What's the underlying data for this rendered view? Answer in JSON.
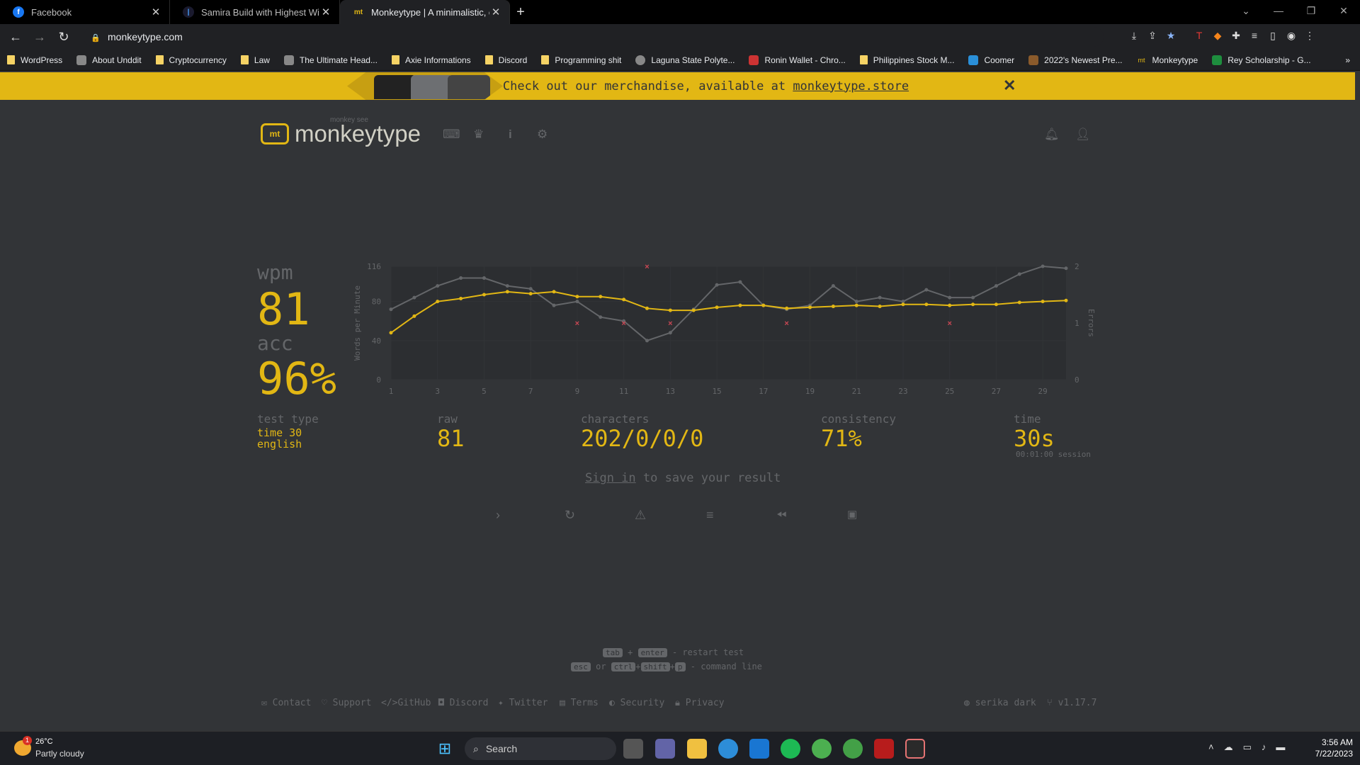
{
  "browser": {
    "tabs": [
      {
        "title": "Facebook",
        "icon": "facebook-icon"
      },
      {
        "title": "Samira Build with Highest Winrat",
        "icon": "blitz-icon"
      },
      {
        "title": "Monkeytype | A minimalistic, cust",
        "icon": "monkeytype-icon"
      }
    ],
    "url": "monkeytype.com",
    "bookmarks": [
      "WordPress",
      "About Unddit",
      "Cryptocurrency",
      "Law",
      "The Ultimate Head...",
      "Axie Informations",
      "Discord",
      "Programming shit",
      "Laguna State Polyte...",
      "Ronin Wallet - Chro...",
      "Philippines Stock M...",
      "Coomer",
      "2022's Newest Pre...",
      "Monkeytype",
      "Rey Scholarship - G..."
    ]
  },
  "banner": {
    "text": "Check out our merchandise, available at ",
    "link": "monkeytype.store",
    "close": "✕"
  },
  "header": {
    "logo": "monkeytype",
    "logo_sub": "monkey see",
    "logo_mark": "mt"
  },
  "result": {
    "wpm_label": "wpm",
    "wpm": "81",
    "acc_label": "acc",
    "acc": "96%",
    "test_type_label": "test type",
    "test_type_1": "time 30",
    "test_type_2": "english",
    "raw_label": "raw",
    "raw": "81",
    "characters_label": "characters",
    "characters": "202/0/0/0",
    "consistency_label": "consistency",
    "consistency": "71%",
    "time_label": "time",
    "time": "30s",
    "session": "00:01:00 session",
    "sign_in": "Sign in",
    "save_text": " to save your result"
  },
  "chart_data": {
    "type": "line",
    "x": [
      1,
      2,
      3,
      4,
      5,
      6,
      7,
      8,
      9,
      10,
      11,
      12,
      13,
      14,
      15,
      16,
      17,
      18,
      19,
      20,
      21,
      22,
      23,
      24,
      25,
      26,
      27,
      28,
      29,
      30
    ],
    "x_ticks": [
      1,
      3,
      5,
      7,
      9,
      11,
      13,
      15,
      17,
      19,
      21,
      23,
      25,
      27,
      29
    ],
    "y_ticks": [
      0,
      40,
      80,
      116
    ],
    "y2_ticks": [
      0,
      1,
      2
    ],
    "ylabel": "Words per Minute",
    "y2label": "Errors",
    "ylim": [
      0,
      116
    ],
    "y2lim": [
      0,
      2
    ],
    "series": [
      {
        "color": "#e2b714",
        "values": [
          48,
          65,
          80,
          83,
          87,
          90,
          88,
          90,
          85,
          85,
          82,
          73,
          71,
          71,
          74,
          76,
          76,
          73,
          74,
          75,
          76,
          75,
          77,
          77,
          76,
          77,
          77,
          79,
          80,
          81
        ]
      },
      {
        "color": "#646669",
        "values": [
          72,
          84,
          96,
          104,
          104,
          96,
          93,
          76,
          80,
          64,
          60,
          40,
          48,
          72,
          97,
          100,
          76,
          72,
          76,
          96,
          80,
          84,
          80,
          92,
          84,
          84,
          96,
          108,
          116,
          114
        ]
      }
    ],
    "errors": [
      {
        "x": 9,
        "y": 1
      },
      {
        "x": 11,
        "y": 1
      },
      {
        "x": 12,
        "y": 2
      },
      {
        "x": 13,
        "y": 1
      },
      {
        "x": 18,
        "y": 1
      },
      {
        "x": 25,
        "y": 1
      }
    ]
  },
  "shortcuts": {
    "k_tab": "tab",
    "plus1": "+",
    "k_enter": "enter",
    "restart": "- restart test",
    "k_esc": "esc",
    "or": "or",
    "k_ctrl": "ctrl",
    "plus2": "+",
    "k_shift": "shift",
    "plus3": "+",
    "k_p": "p",
    "cmd": "- command line"
  },
  "footer": {
    "links": [
      "Contact",
      "Support",
      "GitHub",
      "Discord",
      "Twitter",
      "Terms",
      "Security",
      "Privacy"
    ],
    "theme": "serika dark",
    "version": "v1.17.7"
  },
  "taskbar": {
    "weather_temp": "26°C",
    "weather_desc": "Partly cloudy",
    "search": "Search",
    "time": "3:56 AM",
    "date": "7/22/2023",
    "badge": "1"
  }
}
